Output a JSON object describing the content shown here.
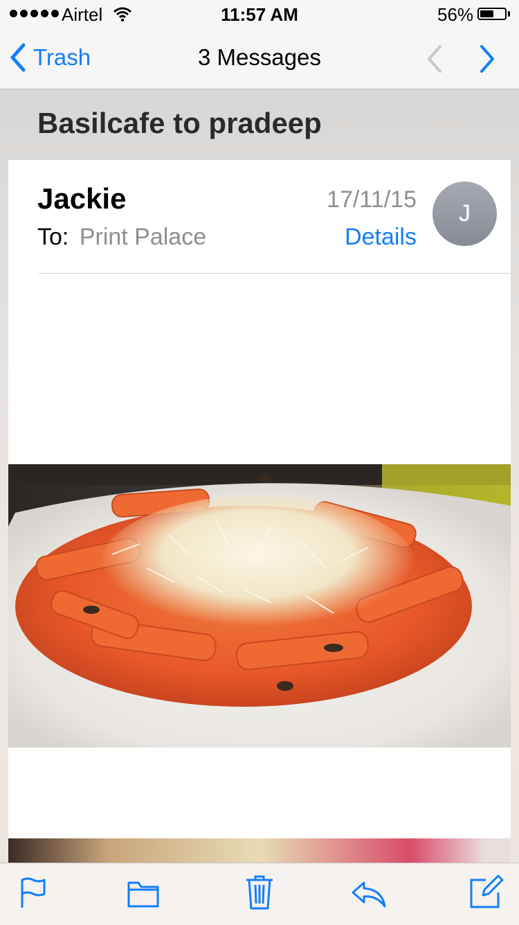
{
  "status_bar": {
    "carrier": "Airtel",
    "time": "11:57 AM",
    "battery": "56%",
    "battery_level": 0.56
  },
  "nav": {
    "back_label": "Trash",
    "title": "3 Messages",
    "back_icon": "chevron-left-icon",
    "prev_icon": "chevron-up-icon",
    "next_icon": "chevron-down-icon"
  },
  "subject": "Basilcafe to pradeep",
  "message": {
    "sender": "Jackie",
    "to_label": "To:",
    "to_value": "Print Palace",
    "date": "17/11/15",
    "details_label": "Details",
    "avatar_initial": "J"
  },
  "toolbar": {
    "flag_icon": "flag-icon",
    "folder_icon": "folder-icon",
    "trash_icon": "trash-icon",
    "reply_icon": "reply-icon",
    "compose_icon": "compose-icon"
  },
  "colors": {
    "accent": "#147efb",
    "secondary_text": "#8e8e93"
  }
}
